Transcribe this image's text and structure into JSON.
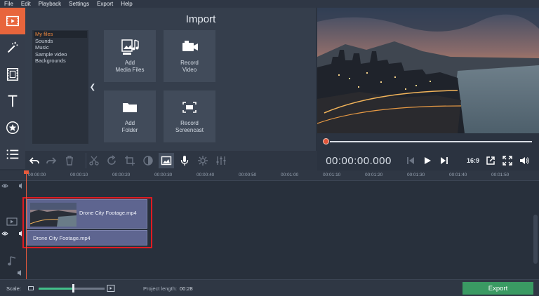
{
  "menu": [
    "File",
    "Edit",
    "Playback",
    "Settings",
    "Export",
    "Help"
  ],
  "tools": [
    "import-icon",
    "magic-wand-icon",
    "filmstrip-icon",
    "text-icon",
    "star-icon",
    "menu-icon"
  ],
  "import_panel": {
    "title": "Import",
    "file_categories": [
      "My files",
      "Sounds",
      "Music",
      "Sample video",
      "Backgrounds"
    ],
    "selected_category": "My files",
    "tiles": [
      {
        "label": "Add\nMedia Files",
        "icon": "media-files-icon"
      },
      {
        "label": "Record\nVideo",
        "icon": "camera-icon"
      },
      {
        "label": "Add\nFolder",
        "icon": "folder-icon"
      },
      {
        "label": "Record\nScreencast",
        "icon": "screencast-icon"
      }
    ]
  },
  "preview": {
    "timecode": "00:00:00.000",
    "aspect_ratio": "16:9",
    "progress": 0
  },
  "timeline": {
    "ruler": [
      "00:00:00",
      "00:00:10",
      "00:00:20",
      "00:00:30",
      "00:00:40",
      "00:00:50",
      "00:01:00",
      "00:01:10",
      "00:01:20",
      "00:01:30",
      "00:01:40",
      "00:01:50"
    ],
    "video_clip_name": "Drone City Footage.mp4",
    "audio_clip_name": "Drone City Footage.mp4"
  },
  "bottom": {
    "scale_label": "Scale:",
    "scale_value": 0.52,
    "project_length_label": "Project length:",
    "project_length": "00:28",
    "export_label": "Export"
  },
  "colors": {
    "accent": "#e8653c",
    "export_green": "#3a9a63",
    "clip": "#5e6590",
    "highlight": "#e01b22"
  }
}
